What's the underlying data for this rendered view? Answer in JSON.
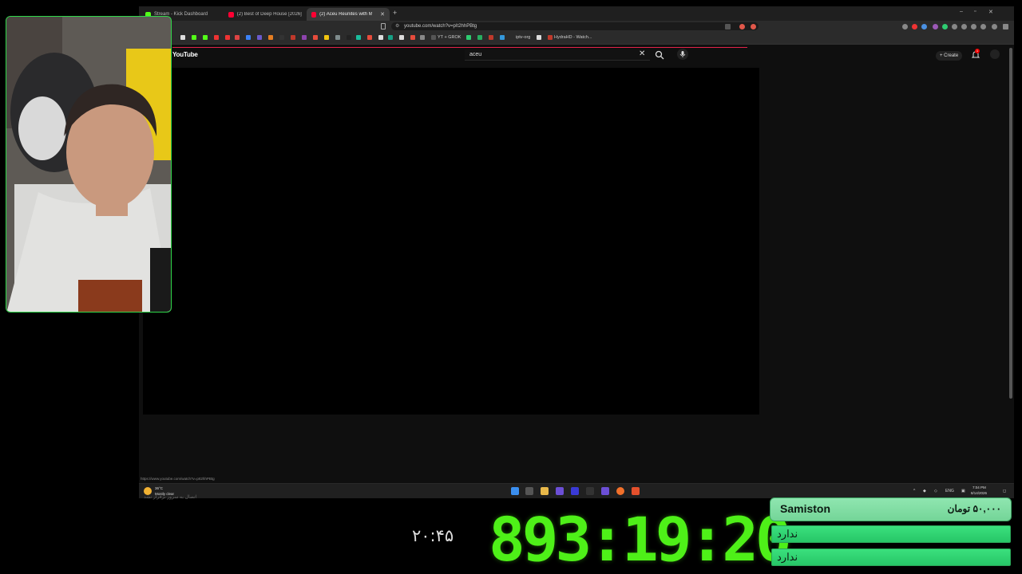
{
  "browser": {
    "tabs": [
      {
        "title": "Stream - Kick Dashboard",
        "color": "#53fc18"
      },
      {
        "title": "(2) Best of Deep House [2026] | Meld...",
        "color": "#ff0033"
      },
      {
        "title": "(2) Aceu Reunites with Mande &...",
        "color": "#ff0033",
        "active": true
      }
    ],
    "new_tab": "+",
    "url": "youtube.com/watch?v=pIt2hhPBtg",
    "bookmarks": [
      "YT + GROK",
      "iptv-org",
      "HydraHD - Watch..."
    ],
    "status_url": "https://www.youtube.com/watch?v=pIt2hhPBtg"
  },
  "youtube": {
    "logo": "YouTube",
    "search_query": "aceu",
    "create_label": "Create",
    "notification_count": "1"
  },
  "taskbar": {
    "weather_temp": "36°C",
    "weather_desc": "Mostly clear",
    "lang": "ENG",
    "time": "7:04 PM",
    "date": "8/14/2026"
  },
  "overlay": {
    "server_status": "اتصال به سرور برقرار نشد",
    "small_timer": "۲۰:۴۵",
    "big_timer": "893:19:20",
    "donation": {
      "name": "Samiston",
      "amount": "۵۰,۰۰۰ تومان",
      "rows": [
        "ندارد",
        "ندارد"
      ]
    }
  },
  "colors": {
    "accent_green": "#4ef018",
    "webcam_border": "#2fd84a",
    "donation_header": "#8fe6b0",
    "donation_row": "#3ae07d"
  }
}
